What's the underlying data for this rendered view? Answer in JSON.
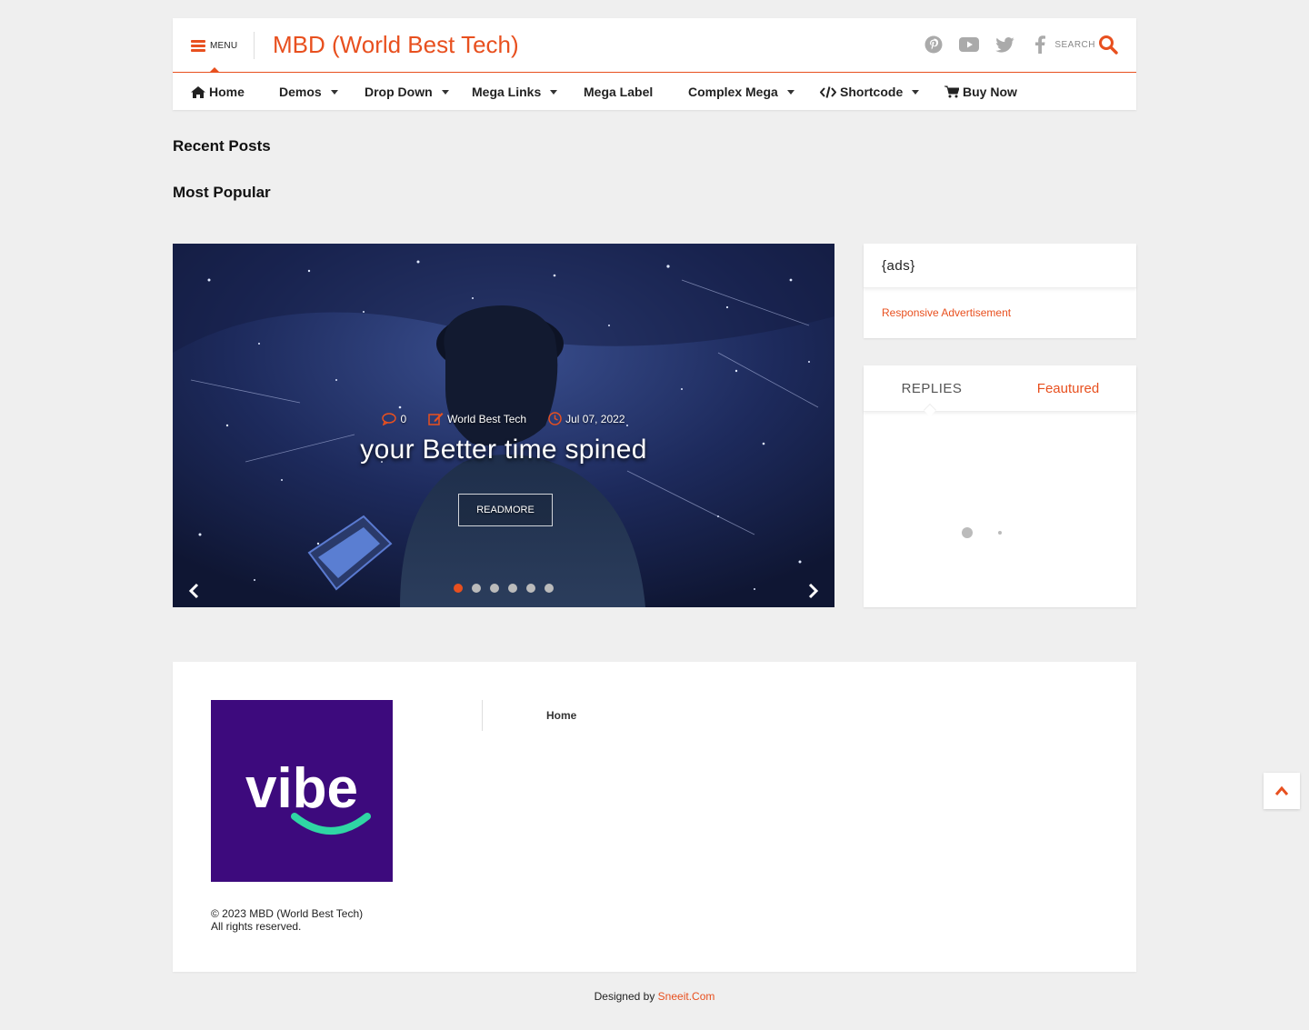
{
  "header": {
    "menu_label": "MENU",
    "site_title": "MBD (World Best Tech)",
    "search_label": "SEARCH",
    "social_icons": [
      "pinterest-icon",
      "youtube-icon",
      "twitter-icon",
      "facebook-icon"
    ],
    "accent_color": "#e8501f"
  },
  "nav": {
    "items": [
      {
        "label": "Home",
        "icon": "home-icon",
        "has_dropdown": false
      },
      {
        "label": "Demos",
        "has_dropdown": true
      },
      {
        "label": "Drop Down",
        "has_dropdown": true
      },
      {
        "label": "Mega Links",
        "has_dropdown": true
      },
      {
        "label": "Mega Label",
        "has_dropdown": false
      },
      {
        "label": "Complex Mega",
        "has_dropdown": true
      },
      {
        "label": "Shortcode",
        "icon": "code-icon",
        "has_dropdown": true
      },
      {
        "label": "Buy Now",
        "icon": "cart-icon",
        "has_dropdown": false
      }
    ]
  },
  "sections": {
    "recent_posts": "Recent Posts",
    "most_popular": "Most Popular"
  },
  "slider": {
    "comments": "0",
    "author": "World Best Tech",
    "date": "Jul 07, 2022",
    "title": "your Better time spined",
    "readmore": "READMORE",
    "slide_count": 6,
    "active_slide": 1
  },
  "sidebar": {
    "ads_title": "{ads}",
    "ads_body": "Responsive Advertisement",
    "tabs": [
      "REPLIES",
      "Feautured"
    ]
  },
  "footer": {
    "logo_text": "vibe",
    "nav_home": "Home",
    "copyright_line1": "© 2023 MBD (World Best Tech)",
    "copyright_line2": "All rights reserved.",
    "designed_by": "Designed by",
    "designer": "Sneeit.Com"
  }
}
